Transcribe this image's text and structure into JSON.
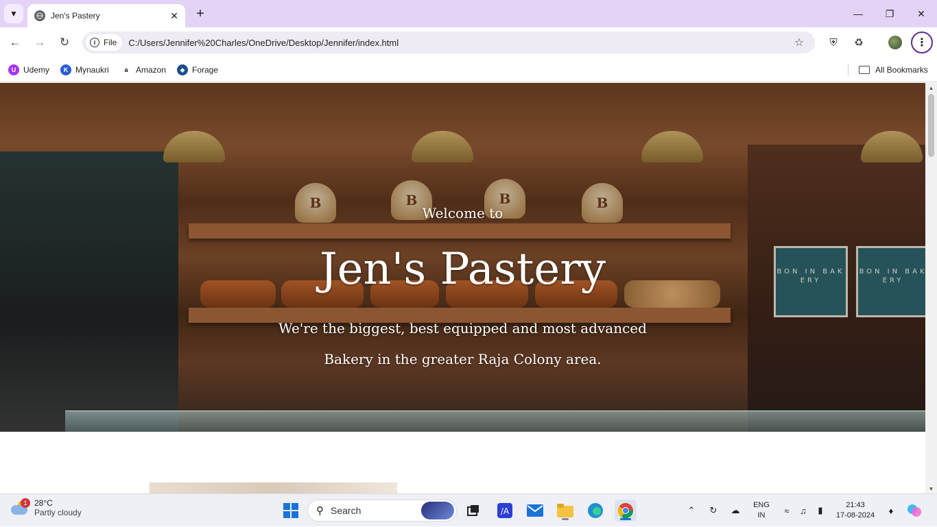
{
  "browser": {
    "tab_title": "Jen's Pastery",
    "chip_label": "File",
    "url": "C:/Users/Jennifer%20Charles/OneDrive/Desktop/Jennifer/index.html",
    "bookmarks": [
      {
        "label": "Udemy",
        "icon": "udemy-icon",
        "color": "#a435f0"
      },
      {
        "label": "Mynaukri",
        "icon": "mynaukri-icon",
        "color": "#2a5bd7"
      },
      {
        "label": "Amazon",
        "icon": "amazon-icon",
        "color": "#ff9900"
      },
      {
        "label": "Forage",
        "icon": "forage-icon",
        "color": "#1b4f8c"
      }
    ],
    "all_bookmarks": "All Bookmarks"
  },
  "hero": {
    "welcome": "Welcome to",
    "brand": "Jen's Pastery",
    "tagline_1": "We're the biggest, best equipped and most advanced",
    "tagline_2": "Bakery in the greater Raja Colony area.",
    "box_text": "BON IN BAK ERY"
  },
  "taskbar": {
    "weather_temp": "28°C",
    "weather_desc": "Partly cloudy",
    "weather_badge": "1",
    "search_label": "Search",
    "lang_1": "ENG",
    "lang_2": "IN",
    "time": "21:43",
    "date": "17-08-2024"
  },
  "colors": {
    "titlebar": "#e3d4f7",
    "accent": "#1a73d9"
  }
}
